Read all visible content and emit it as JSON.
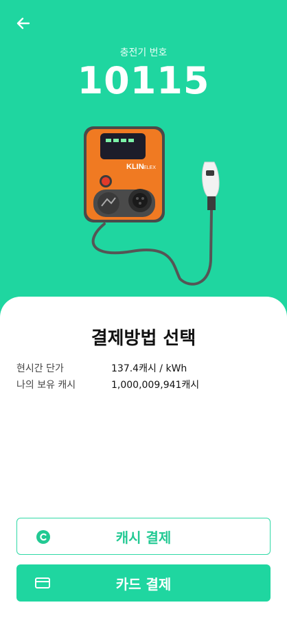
{
  "header": {
    "charger_label": "충전기 번호",
    "charger_number": "10115"
  },
  "charger": {
    "brand": "KLIN",
    "model": "ELEX"
  },
  "payment": {
    "title": "결제방법 선택",
    "rows": [
      {
        "label": "현시간 단가",
        "value": "137.4캐시 / kWh"
      },
      {
        "label": "나의 보유 캐시",
        "value": "1,000,009,941캐시"
      }
    ],
    "cash_button": "캐시 결제",
    "card_button": "카드 결제"
  },
  "colors": {
    "accent": "#1fd6a0",
    "charger_body": "#f07a22"
  },
  "icons": {
    "back": "arrow-left-icon",
    "cash": "cash-coin-icon",
    "card": "credit-card-icon"
  }
}
